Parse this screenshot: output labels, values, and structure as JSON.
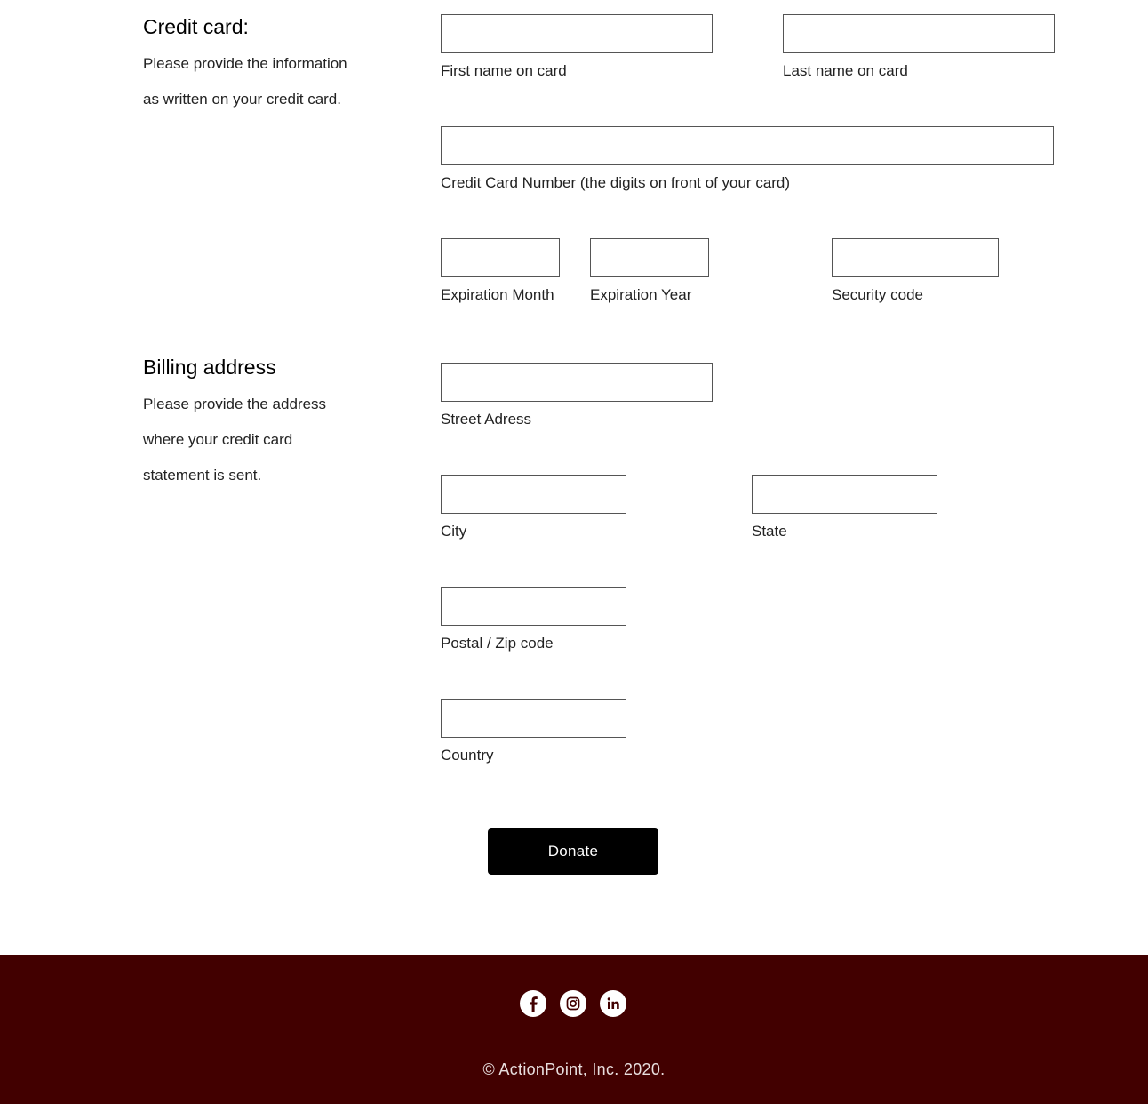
{
  "credit_card": {
    "title": "Credit card:",
    "description_lines": [
      "Please provide the information",
      "as written on your credit card."
    ],
    "fields": {
      "first_name": {
        "label": "First name on card",
        "value": ""
      },
      "last_name": {
        "label": "Last name on card",
        "value": ""
      },
      "card_number": {
        "label": "Credit Card Number (the digits on front of your card)",
        "value": ""
      },
      "exp_month": {
        "label": "Expiration Month",
        "value": ""
      },
      "exp_year": {
        "label": "Expiration Year",
        "value": ""
      },
      "security_code": {
        "label": "Security code",
        "value": ""
      }
    }
  },
  "billing": {
    "title": "Billing address",
    "description_lines": [
      "Please provide the address",
      "where your credit card",
      "statement is sent."
    ],
    "fields": {
      "street": {
        "label": "Street Adress",
        "value": ""
      },
      "city": {
        "label": "City",
        "value": ""
      },
      "state": {
        "label": "State",
        "value": ""
      },
      "postal": {
        "label": "Postal / Zip code",
        "value": ""
      },
      "country": {
        "label": "Country",
        "value": ""
      }
    }
  },
  "actions": {
    "donate_label": "Donate"
  },
  "footer": {
    "background_color": "#420000",
    "social_icons": [
      "facebook-icon",
      "instagram-icon",
      "linkedin-icon"
    ],
    "copyright": "© ActionPoint, Inc. 2020."
  }
}
